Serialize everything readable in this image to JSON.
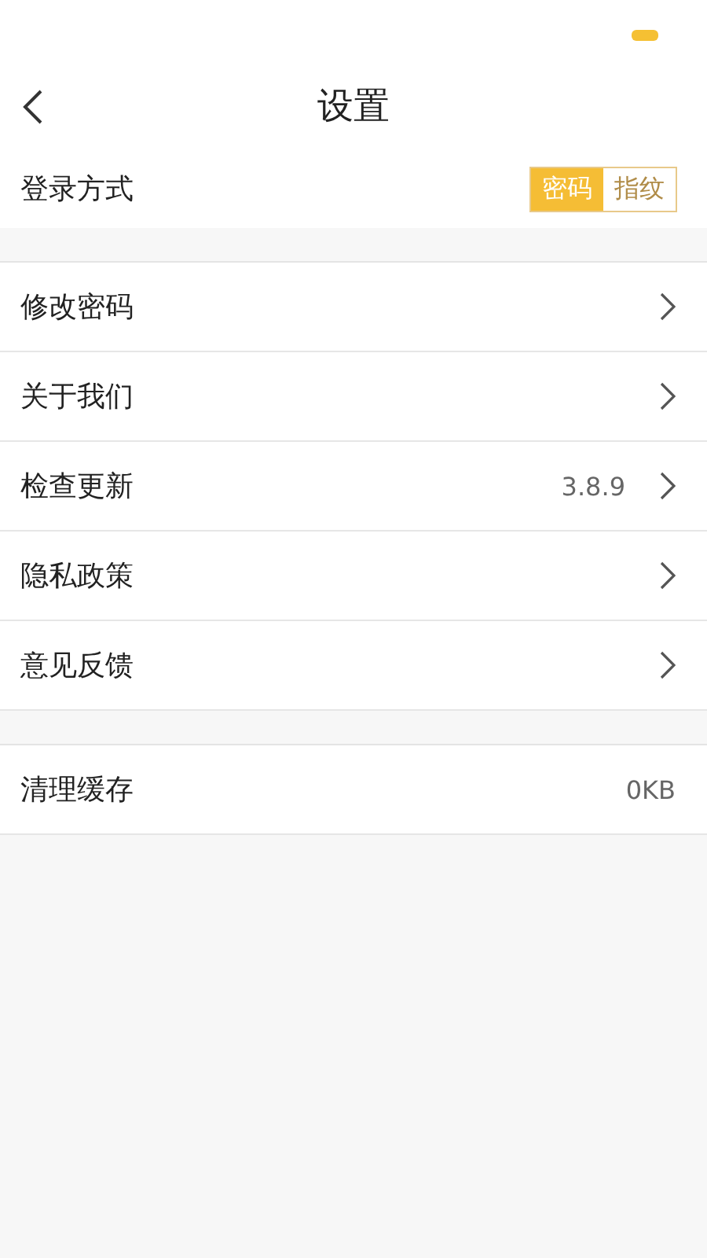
{
  "header": {
    "title": "设置"
  },
  "login": {
    "label": "登录方式",
    "options": [
      {
        "label": "密码",
        "selected": true
      },
      {
        "label": "指纹",
        "selected": false
      }
    ]
  },
  "groups": [
    [
      {
        "kind": "link",
        "label": "修改密码"
      },
      {
        "kind": "link",
        "label": "关于我们"
      },
      {
        "kind": "link",
        "label": "检查更新",
        "value": "3.8.9"
      },
      {
        "kind": "link",
        "label": "隐私政策"
      },
      {
        "kind": "link",
        "label": "意见反馈"
      }
    ],
    [
      {
        "kind": "info",
        "label": "清理缓存",
        "value": "0KB"
      }
    ]
  ]
}
